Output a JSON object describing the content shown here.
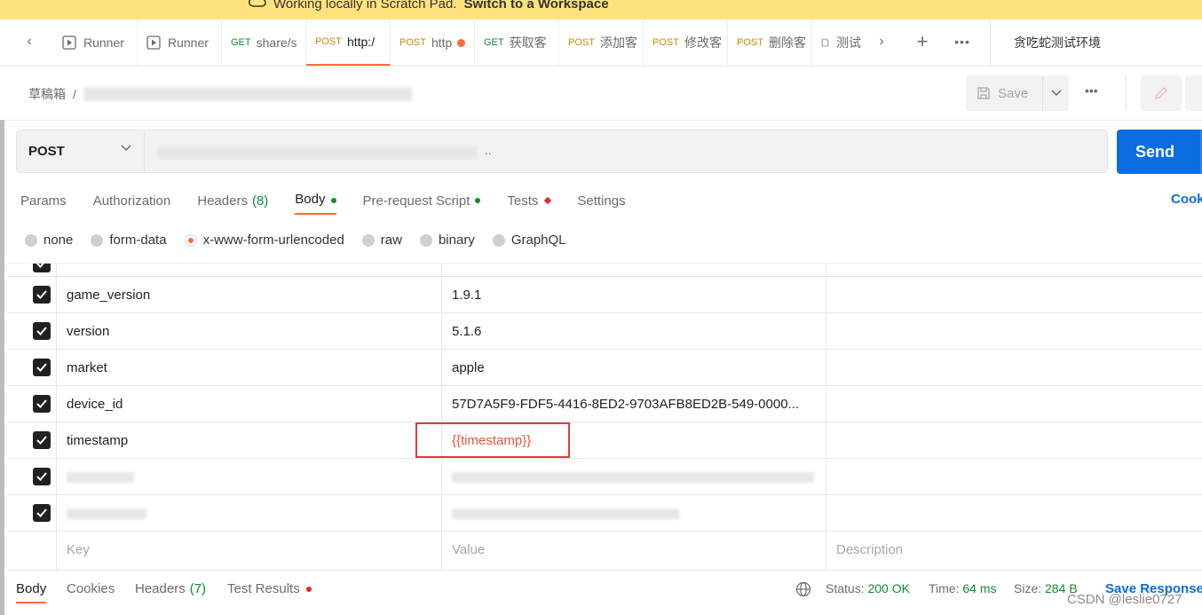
{
  "banner": {
    "text": "Working locally in Scratch Pad.",
    "link": "Switch to a Workspace"
  },
  "tabs": [
    {
      "method": "",
      "label": "Runner",
      "icon": "runner-icon"
    },
    {
      "method": "",
      "label": "Runner",
      "icon": "runner-icon"
    },
    {
      "method": "GET",
      "label": "share/s"
    },
    {
      "method": "POST",
      "label": "http:/",
      "active": true
    },
    {
      "method": "POST",
      "label": "http",
      "unsaved": true
    },
    {
      "method": "GET",
      "label": "获取客"
    },
    {
      "method": "POST",
      "label": "添加客"
    },
    {
      "method": "POST",
      "label": "修改客"
    },
    {
      "method": "POST",
      "label": "删除客"
    },
    {
      "method": "",
      "label": "测试",
      "icon": "document-icon"
    }
  ],
  "environment": "贪吃蛇测试环境",
  "breadcrumb": {
    "folder": "草稿箱",
    "separator": "/"
  },
  "toolbar": {
    "save_label": "Save"
  },
  "request": {
    "method": "POST",
    "url_hint": ".."
  },
  "send_label": "Send",
  "request_tabs": [
    {
      "label": "Params"
    },
    {
      "label": "Authorization"
    },
    {
      "label": "Headers",
      "count": "(8)"
    },
    {
      "label": "Body",
      "indicator": "green-dot",
      "active": true
    },
    {
      "label": "Pre-request Script",
      "indicator": "green-dot"
    },
    {
      "label": "Tests",
      "indicator": "red-diamond"
    },
    {
      "label": "Settings"
    }
  ],
  "cookies_label": "Cook",
  "body_types": [
    "none",
    "form-data",
    "x-www-form-urlencoded",
    "raw",
    "binary",
    "GraphQL"
  ],
  "body_type_selected": "x-www-form-urlencoded",
  "params": [
    {
      "key": "game_version",
      "value": "1.9.1",
      "checked": true
    },
    {
      "key": "version",
      "value": "5.1.6",
      "checked": true
    },
    {
      "key": "market",
      "value": "apple",
      "checked": true
    },
    {
      "key": "device_id",
      "value": "57D7A5F9-FDF5-4416-8ED2-9703AFB8ED2B-549-0000...",
      "checked": true
    },
    {
      "key": "timestamp",
      "value": "{{timestamp}}",
      "checked": true,
      "variable": true
    },
    {
      "key": "",
      "value": "",
      "checked": true,
      "redacted": true
    },
    {
      "key": "",
      "value": "",
      "checked": true,
      "redacted": true
    }
  ],
  "placeholders": {
    "key": "Key",
    "value": "Value",
    "description": "Description"
  },
  "response_tabs": [
    {
      "label": "Body",
      "active": true
    },
    {
      "label": "Cookies"
    },
    {
      "label": "Headers",
      "count": "(7)"
    },
    {
      "label": "Test Results",
      "indicator": "red-dot"
    }
  ],
  "response_meta": {
    "status_label": "Status:",
    "status_value": "200 OK",
    "time_label": "Time:",
    "time_value": "64 ms",
    "size_label": "Size:",
    "size_value": "284 B"
  },
  "save_response_label": "Save Response",
  "watermark": "CSDN @leslie0727",
  "colors": {
    "accent": "#ff6c37",
    "send": "#0b6de0",
    "get": "#0a8e2e",
    "post": "#ce8a00",
    "banner": "#fde27e",
    "highlight": "#e13b3b"
  }
}
